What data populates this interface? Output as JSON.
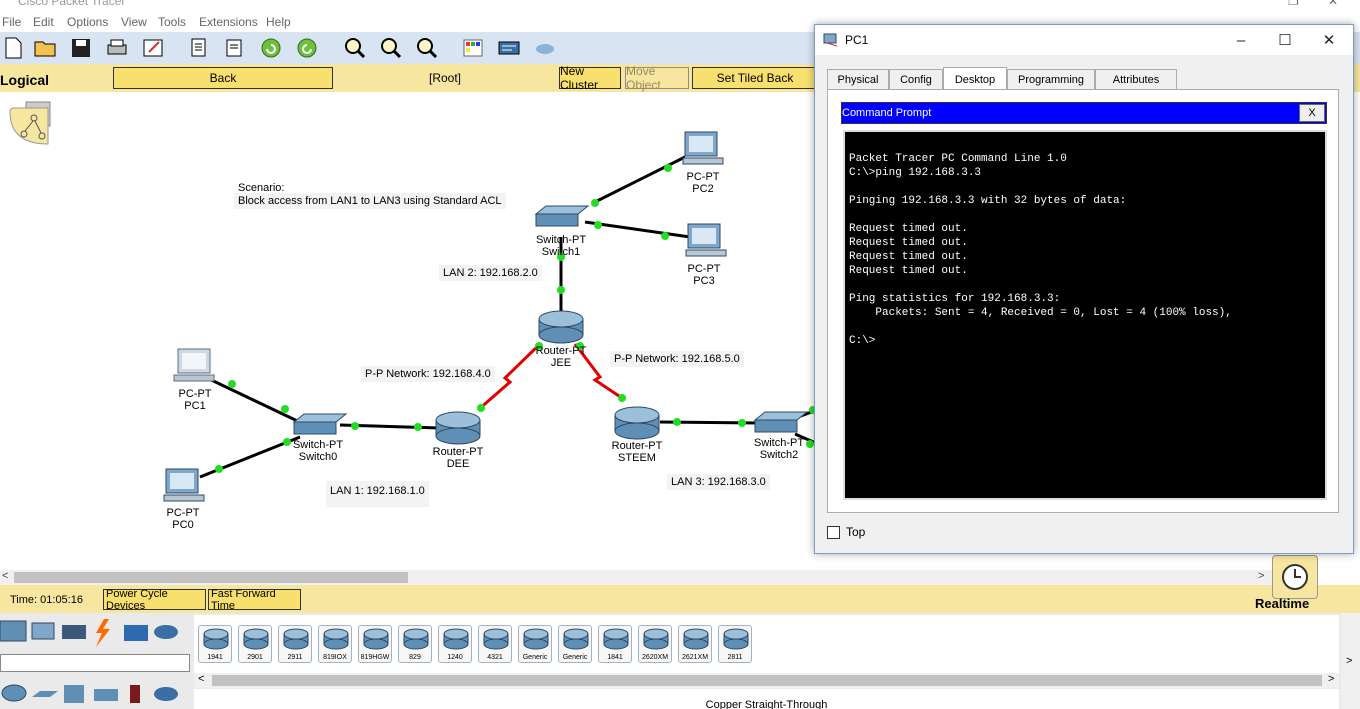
{
  "app": {
    "title": "Cisco Packet Tracer",
    "menu": [
      "File",
      "Edit",
      "Options",
      "View",
      "Tools",
      "Extensions",
      "Help"
    ]
  },
  "logical_bar": {
    "label": "Logical",
    "back": "Back",
    "root": "[Root]",
    "new_cluster": "New Cluster",
    "move_object": "Move Object",
    "set_tiled": "Set Tiled Back"
  },
  "topology": {
    "scenario_title": "Scenario:",
    "scenario_text": "Block access from LAN1 to LAN3 using Standard ACL",
    "lan2": "LAN 2: 192.168.2.0",
    "lan1": "LAN 1: 192.168.1.0",
    "lan3": "LAN 3: 192.168.3.0",
    "pp4": "P-P Network: 192.168.4.0",
    "pp5": "P-P Network: 192.168.5.0",
    "devices": {
      "pc2": {
        "type": "PC-PT",
        "name": "PC2"
      },
      "pc3": {
        "type": "PC-PT",
        "name": "PC3"
      },
      "switch1": {
        "type": "Switch-PT",
        "name": "Switch1"
      },
      "router_jee": {
        "type": "Router-PT",
        "name": "JEE"
      },
      "pc1": {
        "type": "PC-PT",
        "name": "PC1"
      },
      "pc0": {
        "type": "PC-PT",
        "name": "PC0"
      },
      "switch0": {
        "type": "Switch-PT",
        "name": "Switch0"
      },
      "router_dee": {
        "type": "Router-PT",
        "name": "DEE"
      },
      "router_steem": {
        "type": "Router-PT",
        "name": "STEEM"
      },
      "switch2": {
        "type": "Switch-PT",
        "name": "Switch2"
      }
    }
  },
  "timebar": {
    "time": "Time: 01:05:16",
    "power_cycle": "Power Cycle Devices",
    "fast_forward": "Fast Forward Time",
    "mode": "Realtime"
  },
  "palette": {
    "routers": [
      "1941",
      "2901",
      "2911",
      "819IOX",
      "819HGW",
      "829",
      "1240",
      "4321",
      "Generic",
      "Generic",
      "1841",
      "2620XM",
      "2621XM",
      "2811"
    ],
    "caption": "Copper Straight-Through"
  },
  "pc1_window": {
    "title": "PC1",
    "tabs": [
      "Physical",
      "Config",
      "Desktop",
      "Programming",
      "Attributes"
    ],
    "active_tab": "Desktop",
    "cmd_title": "Command Prompt",
    "cmd_close": "X",
    "terminal_lines": "Packet Tracer PC Command Line 1.0\nC:\\>ping 192.168.3.3\n\nPinging 192.168.3.3 with 32 bytes of data:\n\nRequest timed out.\nRequest timed out.\nRequest timed out.\nRequest timed out.\n\nPing statistics for 192.168.3.3:\n    Packets: Sent = 4, Received = 0, Lost = 4 (100% loss),\n\nC:\\>",
    "top_checkbox": "Top"
  },
  "colors": {
    "toolbar": "#d9e4f2",
    "yellow_bar": "#f7e6a0",
    "serial_link": "#e00000",
    "link_dot": "#22dd22"
  }
}
